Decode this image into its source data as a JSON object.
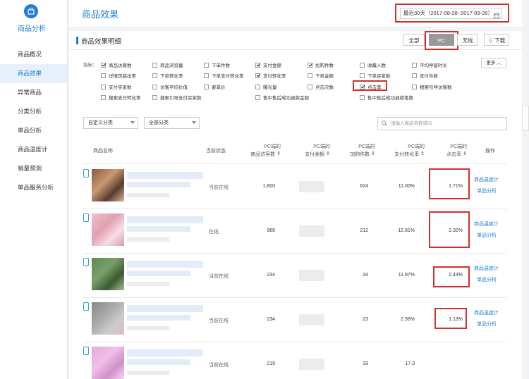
{
  "sidebar": {
    "title": "商品分析",
    "items": [
      {
        "label": "商品概况"
      },
      {
        "label": "商品效果"
      },
      {
        "label": "异常商品"
      },
      {
        "label": "分类分析"
      },
      {
        "label": "单品分析"
      },
      {
        "label": "商品温度计"
      },
      {
        "label": "销量预测"
      },
      {
        "label": "单品服务分析"
      }
    ],
    "active_index": 1
  },
  "header": {
    "title": "商品效果",
    "date_range": "最近30天（2017-08-28~2017-09-26）"
  },
  "panel": {
    "title": "商品效果明细",
    "segments": [
      "全部",
      "PC",
      "无线"
    ],
    "selected_segment": "PC",
    "download_label": "下载"
  },
  "metrics": {
    "label": "指标：",
    "more_label": "更多",
    "rows": [
      [
        {
          "label": "商品访客数",
          "checked": true
        },
        {
          "label": "商品浏览量",
          "checked": false
        },
        {
          "label": "下单件数",
          "checked": false
        },
        {
          "label": "支付金额",
          "checked": true
        },
        {
          "label": "加购件数",
          "checked": true
        },
        {
          "label": "收藏人数",
          "checked": false
        },
        {
          "label": "平均停留时长",
          "checked": false
        }
      ],
      [
        {
          "label": "详情页跳出率",
          "checked": false
        },
        {
          "label": "下单转化率",
          "checked": false
        },
        {
          "label": "下单支付转化率",
          "checked": false
        },
        {
          "label": "支付转化率",
          "checked": true
        },
        {
          "label": "下单金额",
          "checked": false
        },
        {
          "label": "下单买家数",
          "checked": false
        },
        {
          "label": "支付件数",
          "checked": false
        }
      ],
      [
        {
          "label": "支付买家数",
          "checked": false
        },
        {
          "label": "访客平均价值",
          "checked": false
        },
        {
          "label": "客单价",
          "checked": false
        },
        {
          "label": "曝光量",
          "checked": false
        },
        {
          "label": "点击次数",
          "checked": false
        },
        {
          "label": "点击率",
          "checked": true
        },
        {
          "label": "搜索引导访客数",
          "checked": false
        }
      ],
      [
        {
          "label": "搜索支付转化率",
          "checked": false
        },
        {
          "label": "搜索引导支付买家数",
          "checked": false
        },
        {
          "label": "",
          "checked": false
        },
        {
          "label": "售中售后成功退款金额",
          "checked": false
        },
        {
          "label": "",
          "checked": false
        },
        {
          "label": "售中售后成功退款笔数",
          "checked": false
        }
      ]
    ]
  },
  "filters": {
    "custom_category": "自定义分类",
    "all_category": "全部分类",
    "search_placeholder": "请输入商品名称或ID"
  },
  "table": {
    "headers": {
      "name": "商品名称",
      "status": "当前状态",
      "visitors": [
        "PC端的",
        "商品访客数"
      ],
      "pay_amount": [
        "PC端的",
        "支付金额"
      ],
      "cart": [
        "PC端的",
        "加购件数"
      ],
      "conversion": [
        "PC端的",
        "支付转化率"
      ],
      "click_rate": [
        "PC端的",
        "点击率"
      ],
      "action": "操作"
    },
    "rows": [
      {
        "status": "当前在线",
        "visitors": "1,800",
        "cart": "624",
        "conversion": "11.00%",
        "click_rate": "1.71%",
        "op1": "商品温度计",
        "op2": "单品分析"
      },
      {
        "status": "在线",
        "visitors": "968",
        "cart": "212",
        "conversion": "12.81%",
        "click_rate": "2.32%",
        "op1": "商品温度计",
        "op2": "单品分析"
      },
      {
        "status": "当前在线",
        "visitors": "234",
        "cart": "34",
        "conversion": "11.97%",
        "click_rate": "2.43%",
        "op1": "商品温度计",
        "op2": "单品分析"
      },
      {
        "status": "当前在线",
        "visitors": "234",
        "cart": "23",
        "conversion": "2.56%",
        "click_rate": "1.13%",
        "op1": "商品温度计",
        "op2": "单品分析"
      },
      {
        "status": "当前在线",
        "visitors": "219",
        "cart": "33",
        "conversion": "17.3",
        "click_rate": "",
        "op1": "",
        "op2": ""
      }
    ]
  },
  "colors": {
    "accent": "#1e7dd8",
    "highlight": "#d0312d"
  }
}
